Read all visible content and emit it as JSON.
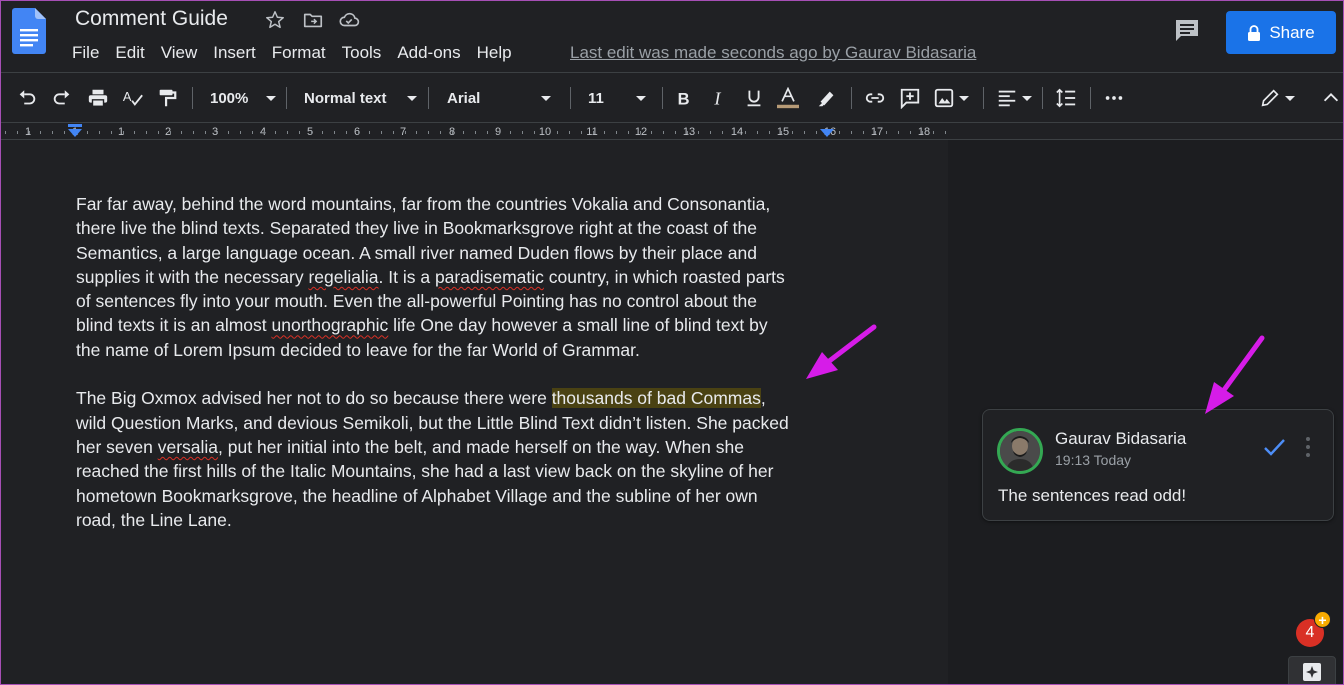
{
  "app": {
    "title": "Comment Guide",
    "last_edit": "Last edit was made seconds ago by Gaurav Bidasaria",
    "share_label": "Share",
    "icons": [
      "star-icon",
      "move-to-folder-icon",
      "cloud-saved-icon",
      "comments-icon",
      "lock-icon"
    ]
  },
  "menu": {
    "items": [
      "File",
      "Edit",
      "View",
      "Insert",
      "Format",
      "Tools",
      "Add-ons",
      "Help"
    ]
  },
  "toolbar": {
    "zoom": "100%",
    "style": "Normal text",
    "font": "Arial",
    "font_size": "11"
  },
  "ruler": {
    "labels": [
      "1",
      "1",
      "1",
      "2",
      "3",
      "4",
      "5",
      "6",
      "7",
      "8",
      "9",
      "10",
      "11",
      "12",
      "13",
      "14",
      "15",
      "16",
      "17",
      "18"
    ]
  },
  "document": {
    "paragraph1": [
      "Far far away, behind the word mountains, far from the countries Vokalia and Consonantia,",
      "there live the blind texts. Separated they live in Bookmarksgrove right at the coast of the",
      "Semantics, a large language ocean. A small river named Duden flows by their place and",
      "supplies it with the necessary ",
      "regelialia",
      ". It is a ",
      "paradisematic",
      " country, in which roasted parts",
      "of sentences fly into your mouth. Even the all-powerful Pointing has no control about the",
      "blind texts it is an almost ",
      "unorthographic",
      " life One day however a small line of blind text by",
      "the name of Lorem Ipsum decided to leave for the far World of Grammar."
    ],
    "paragraph2": [
      "The Big Oxmox advised her not to do so because there were ",
      "thousands of bad Commas",
      ",",
      "wild Question Marks, and devious Semikoli, but the Little Blind Text didn’t listen. She packed",
      "her seven ",
      "versalia",
      ", put her initial into the belt, and made herself on the way. When she",
      "reached the first hills of the Italic Mountains, she had a last view back on the skyline of her",
      "hometown Bookmarksgrove, the headline of Alphabet Village and the subline of her own",
      "road, the Line Lane."
    ]
  },
  "comment": {
    "author": "Gaurav Bidasaria",
    "time": "19:13 Today",
    "body": "The sentences read odd!"
  },
  "notifications": {
    "count": "4",
    "plus": "+"
  },
  "colors": {
    "background": "#202124",
    "accent": "#1a73e8",
    "highlight": "#4a4213",
    "annotation_arrow": "#d61ce8"
  }
}
